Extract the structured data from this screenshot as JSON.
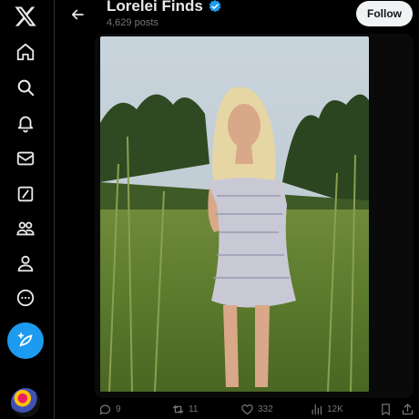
{
  "profile": {
    "name": "Lorelei Finds",
    "posts_count": "4,629 posts",
    "follow_label": "Follow",
    "verified": true
  },
  "nav": {
    "items": [
      {
        "icon": "x-logo-icon"
      },
      {
        "icon": "home-icon"
      },
      {
        "icon": "search-icon"
      },
      {
        "icon": "bell-icon"
      },
      {
        "icon": "mail-icon"
      },
      {
        "icon": "grok-icon"
      },
      {
        "icon": "communities-icon"
      },
      {
        "icon": "profile-icon"
      },
      {
        "icon": "more-icon"
      },
      {
        "icon": "post-icon"
      }
    ]
  },
  "actions": {
    "replies": "9",
    "reposts": "11",
    "likes": "332",
    "views": "12K"
  },
  "colors": {
    "background": "#000000",
    "accent": "#1d9bf0",
    "muted": "#71767b",
    "follow_bg": "#eff3f4"
  }
}
